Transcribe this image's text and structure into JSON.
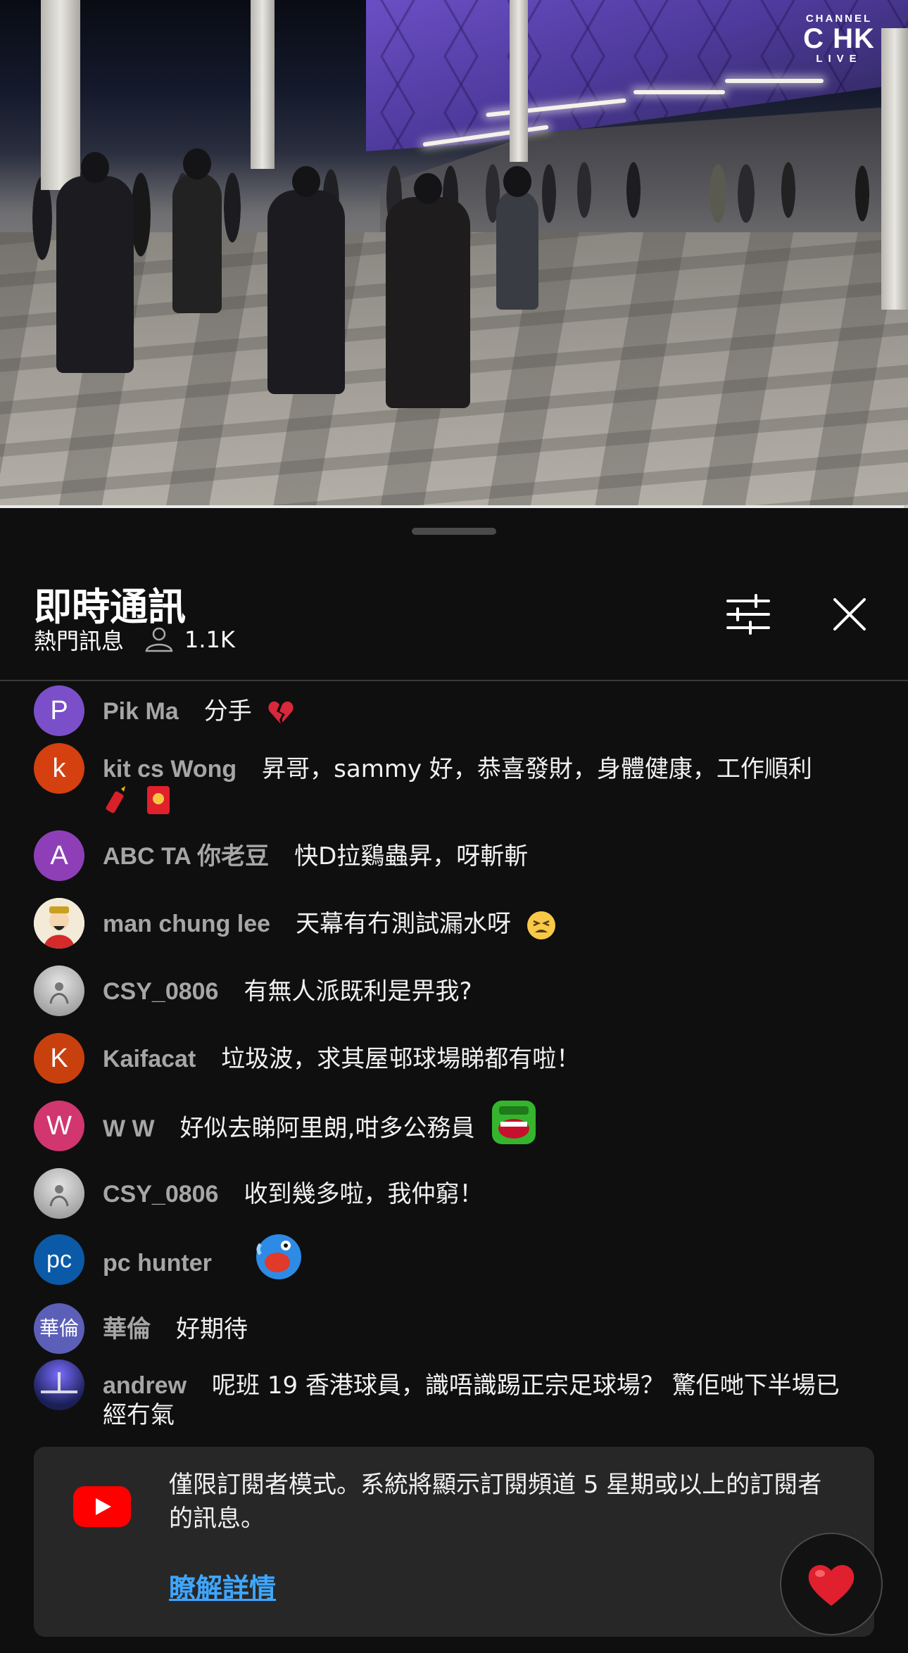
{
  "video": {
    "channel_logo": {
      "top": "CHANNEL",
      "mid": "C HK",
      "bottom": "LIVE"
    },
    "progress_fraction": 0.995
  },
  "chat": {
    "title": "即時通訊",
    "mode_label": "熱門訊息",
    "viewer_count": "1.1K",
    "icons": {
      "filter": "tune-icon",
      "close": "close-icon",
      "viewers": "person-icon"
    },
    "messages": [
      {
        "avatar_letter": "P",
        "avatar_color": "#7b4fc9",
        "author": "Pik Ma",
        "text": "分手",
        "emoji": "broken-heart-icon"
      },
      {
        "avatar_letter": "k",
        "avatar_color": "#d4400f",
        "author": "kit cs Wong",
        "text": "昇哥，sammy 好，恭喜發財，身體健康，工作順利",
        "emoji": "firecracker-red-envelope-icon"
      },
      {
        "avatar_letter": "A",
        "avatar_color": "#8e3fb8",
        "author": "ABC TA 你老豆",
        "text": "快D拉鷄蟲昇，呀斬斬",
        "emoji": ""
      },
      {
        "avatar_letter": "",
        "avatar_color": "#e8e0d0",
        "author": "man chung lee",
        "text": "天幕有冇測試漏水呀",
        "emoji": "tired-face-icon"
      },
      {
        "avatar_letter": "",
        "avatar_color": "#9a9a9a",
        "author": "CSY_0806",
        "text": "有無人派既利是畀我?",
        "emoji": ""
      },
      {
        "avatar_letter": "K",
        "avatar_color": "#c9400f",
        "author": "Kaifacat",
        "text": "垃圾波，求其屋邨球場睇都有啦！",
        "emoji": ""
      },
      {
        "avatar_letter": "W",
        "avatar_color": "#d1366e",
        "author": "W W",
        "text": "好似去睇阿里朗,咁多公務員",
        "emoji": "green-laughing-face-icon"
      },
      {
        "avatar_letter": "",
        "avatar_color": "#9a9a9a",
        "author": "CSY_0806",
        "text": "收到幾多啦，我仲窮！",
        "emoji": ""
      },
      {
        "avatar_letter": "pc",
        "avatar_color": "#0b5aa8",
        "author": "pc hunter",
        "text": "",
        "emoji": "blue-crying-face-icon"
      },
      {
        "avatar_letter": "華倫",
        "avatar_color": "#5b5fb8",
        "author": "華倫",
        "text": "好期待",
        "emoji": ""
      },
      {
        "avatar_letter": "",
        "avatar_color": "#2a3a8a",
        "author": "andrew",
        "text": "呢班 19 香港球員，識唔識踢正宗足球場？ 驚佢哋下半場已經冇氣",
        "emoji": ""
      }
    ],
    "notice": {
      "text": "僅限訂閱者模式。系統將顯示訂閱頻道 5 星期或以上的訂閱者的訊息。",
      "link_label": "瞭解詳情",
      "icon": "youtube-logo-icon"
    },
    "reaction_icon": "heart-icon"
  }
}
